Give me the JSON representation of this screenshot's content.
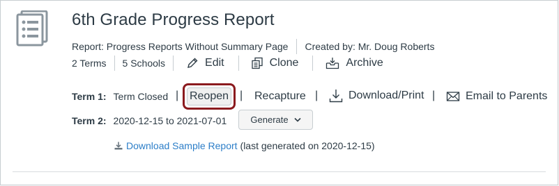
{
  "report": {
    "title": "6th Grade Progress Report",
    "report_type": "Report: Progress Reports Without Summary Page",
    "created_by": "Created by: Mr. Doug Roberts"
  },
  "actions": {
    "terms": "2 Terms",
    "schools": "5 Schools",
    "edit": "Edit",
    "clone": "Clone",
    "archive": "Archive"
  },
  "term1": {
    "label": "Term 1:",
    "status": "Term Closed",
    "pipe": "|",
    "reopen": "Reopen",
    "recapture": "Recapture",
    "download_print": "Download/Print",
    "email_parents": "Email to Parents"
  },
  "term2": {
    "label": "Term 2:",
    "dates": "2020-12-15 to 2021-07-01",
    "generate": "Generate"
  },
  "sample": {
    "link": "Download Sample Report",
    "note": "(last generated on 2020-12-15)"
  },
  "colors": {
    "link": "#2c7ec8",
    "highlight_border": "#8b1a1e",
    "text": "#2d3b45"
  }
}
